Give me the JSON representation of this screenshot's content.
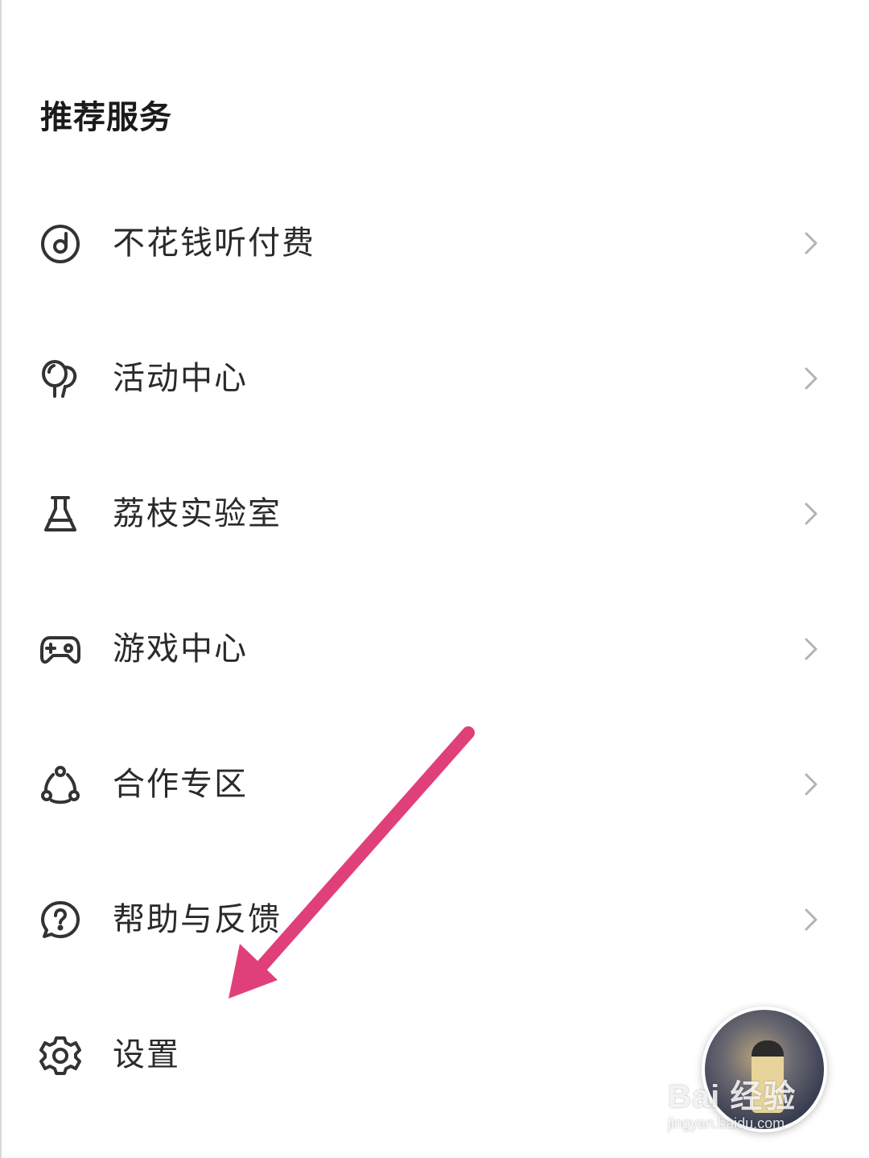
{
  "section": {
    "title": "推荐服务"
  },
  "menu": {
    "items": [
      {
        "label": "不花钱听付费",
        "icon": "music-disc-icon",
        "has_chevron": true
      },
      {
        "label": "活动中心",
        "icon": "balloon-icon",
        "has_chevron": true
      },
      {
        "label": "荔枝实验室",
        "icon": "flask-icon",
        "has_chevron": true
      },
      {
        "label": "游戏中心",
        "icon": "gamepad-icon",
        "has_chevron": true
      },
      {
        "label": "合作专区",
        "icon": "cooperation-icon",
        "has_chevron": true
      },
      {
        "label": "帮助与反馈",
        "icon": "help-bubble-icon",
        "has_chevron": true
      },
      {
        "label": "设置",
        "icon": "gear-icon",
        "has_chevron": false
      }
    ]
  },
  "annotation": {
    "arrow_color": "#e0407a"
  },
  "watermark": {
    "main": "Bai 经验",
    "sub": "jingyan.baidu.com"
  },
  "colors": {
    "text": "#2a2a2a",
    "icon": "#333333",
    "chevron": "#b3b3b3"
  }
}
